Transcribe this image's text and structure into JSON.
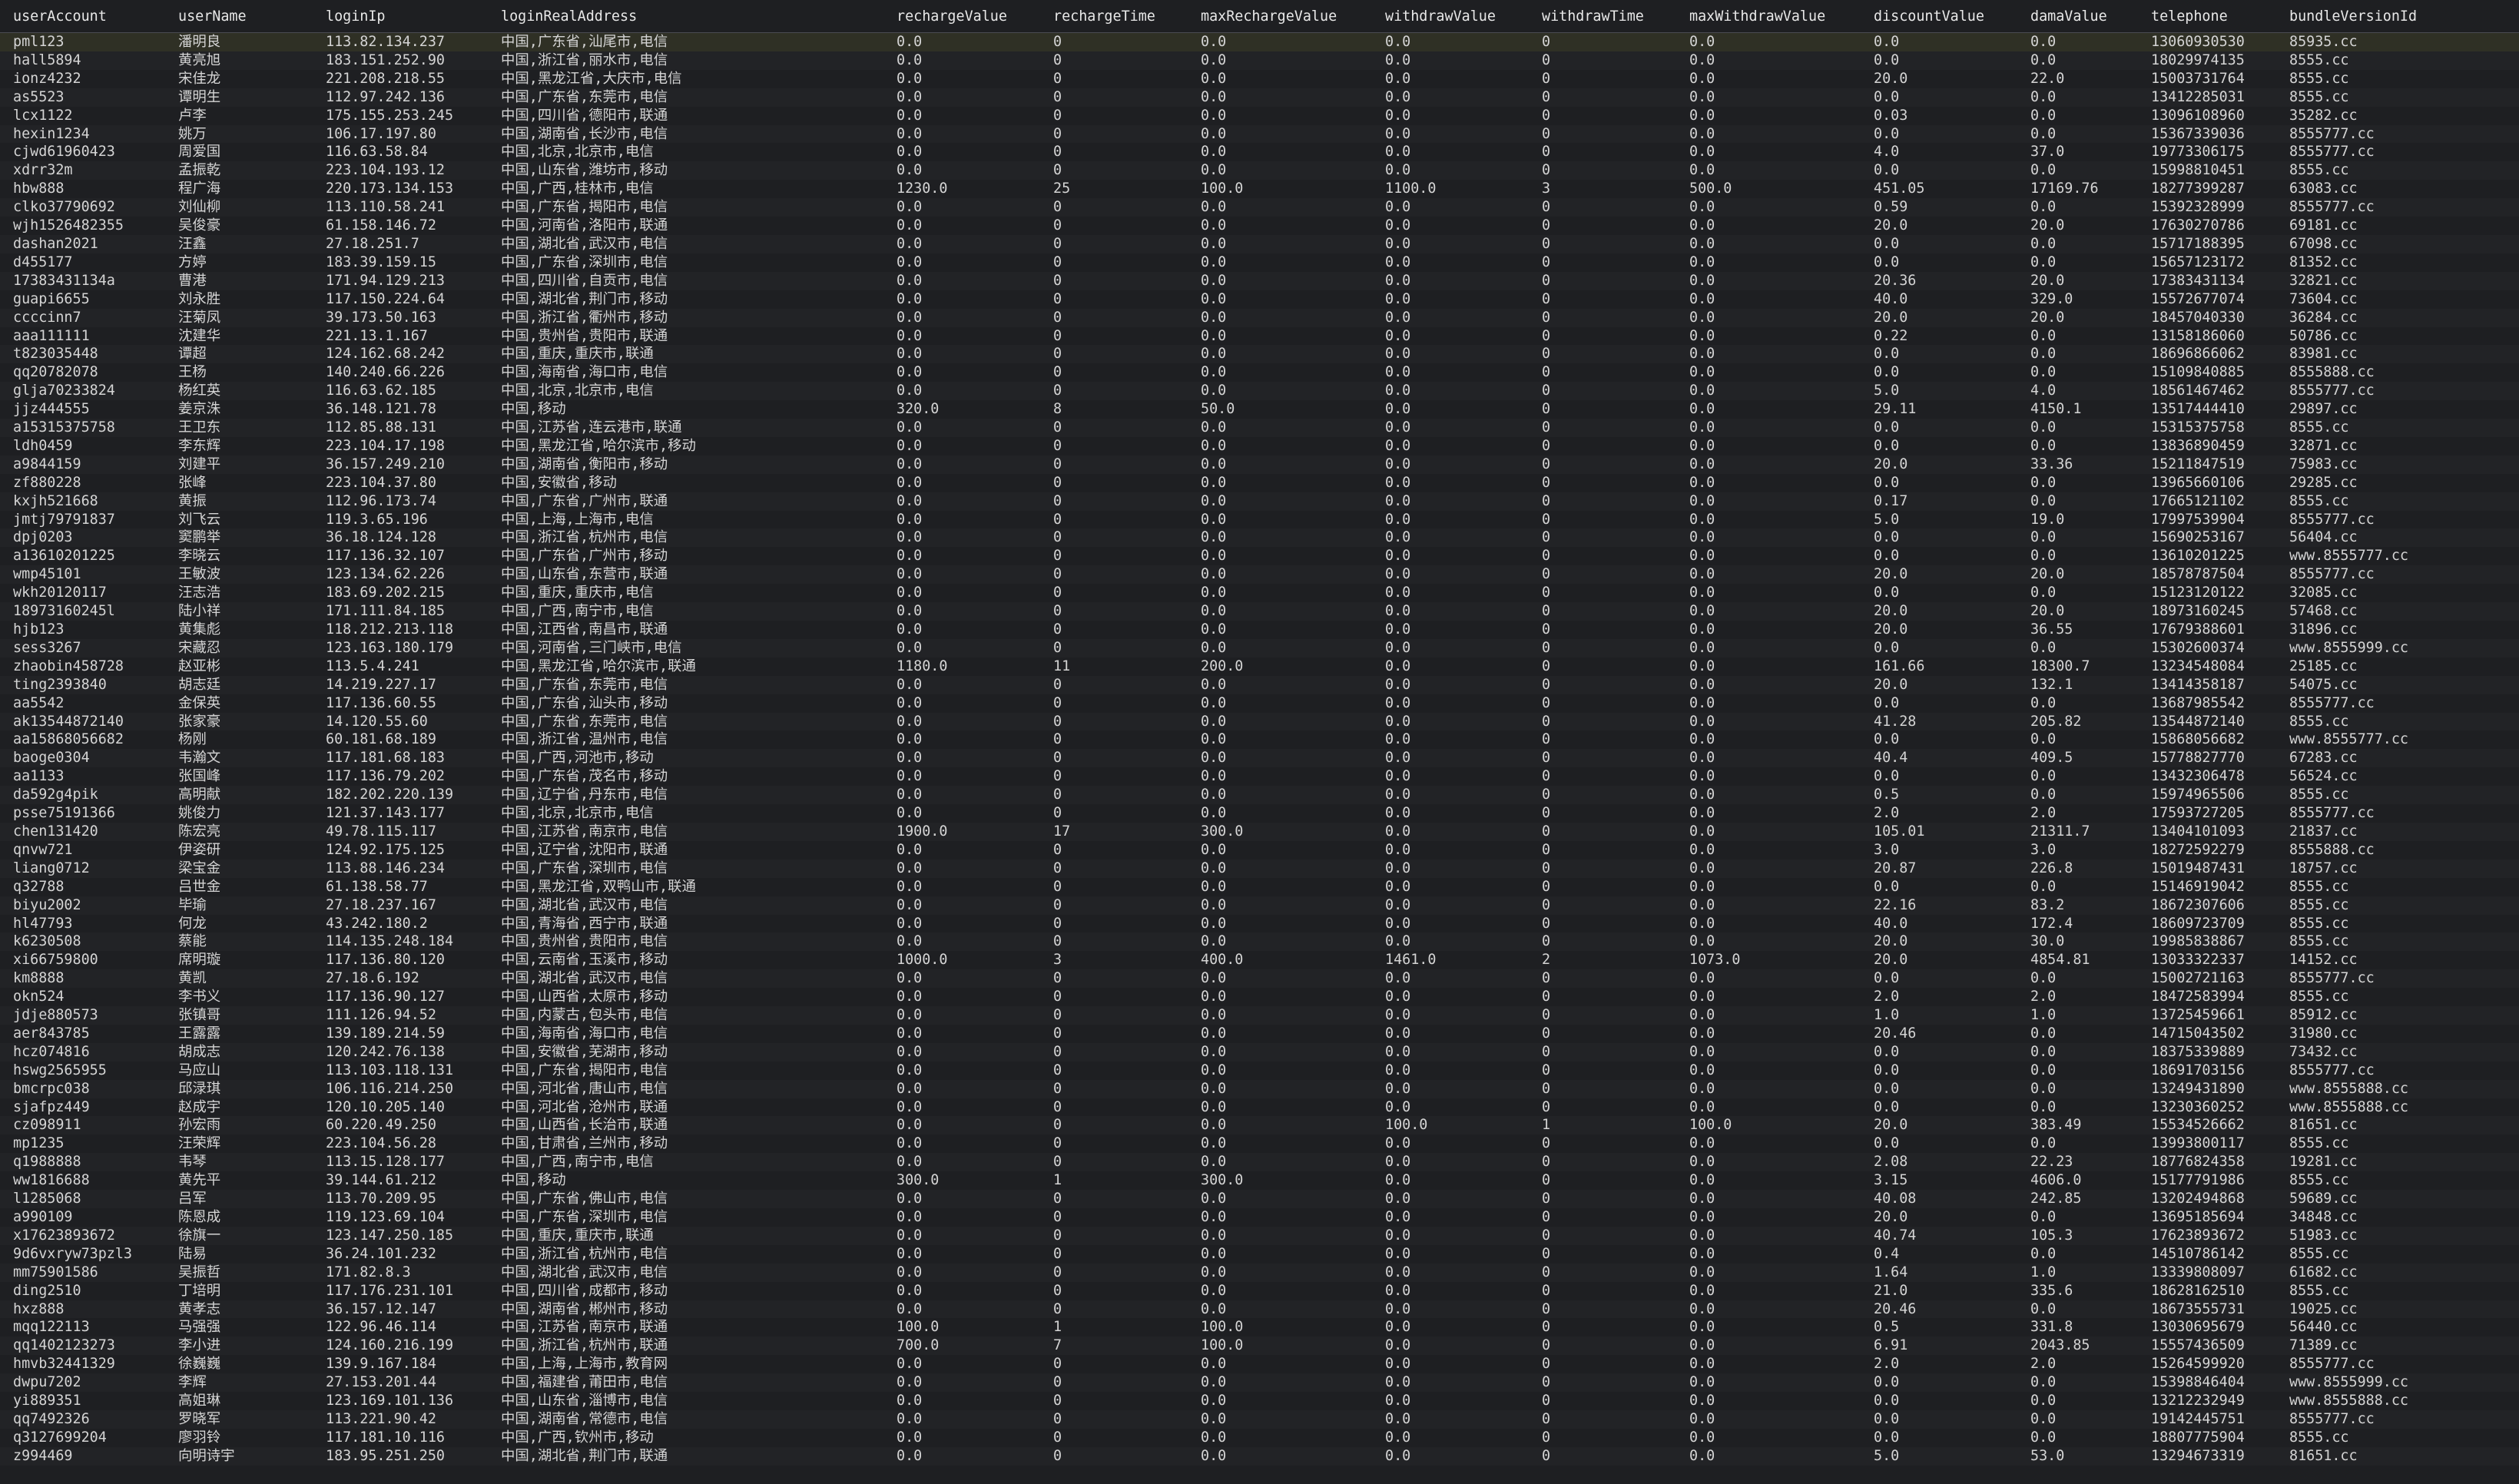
{
  "columns": [
    "userAccount",
    "userName",
    "loginIp",
    "loginRealAddress",
    "rechargeValue",
    "rechargeTime",
    "maxRechargeValue",
    "withdrawValue",
    "withdrawTime",
    "maxWithdrawValue",
    "discountValue",
    "damaValue",
    "telephone",
    "bundleVersionId"
  ],
  "colors": {
    "background": "#1e1f22",
    "text": "#d4d4d4",
    "selectedRow": "#2f3025"
  },
  "selected_row": 0,
  "rows": [
    [
      "pml123",
      "潘明良",
      "113.82.134.237",
      "中国,广东省,汕尾市,电信",
      "0.0",
      "0",
      "0.0",
      "0.0",
      "0",
      "0.0",
      "0.0",
      "0.0",
      "13060930530",
      "85935.cc"
    ],
    [
      "hall5894",
      "黄亮旭",
      "183.151.252.90",
      "中国,浙江省,丽水市,电信",
      "0.0",
      "0",
      "0.0",
      "0.0",
      "0",
      "0.0",
      "0.0",
      "0.0",
      "18029974135",
      "8555.cc"
    ],
    [
      "ionz4232",
      "宋佳龙",
      "221.208.218.55",
      "中国,黑龙江省,大庆市,电信",
      "0.0",
      "0",
      "0.0",
      "0.0",
      "0",
      "0.0",
      "20.0",
      "22.0",
      "15003731764",
      "8555.cc"
    ],
    [
      "as5523",
      "谭明生",
      "112.97.242.136",
      "中国,广东省,东莞市,电信",
      "0.0",
      "0",
      "0.0",
      "0.0",
      "0",
      "0.0",
      "0.0",
      "0.0",
      "13412285031",
      "8555.cc"
    ],
    [
      "lcx1122",
      "卢李",
      "175.155.253.245",
      "中国,四川省,德阳市,联通",
      "0.0",
      "0",
      "0.0",
      "0.0",
      "0",
      "0.0",
      "0.03",
      "0.0",
      "13096108960",
      "35282.cc"
    ],
    [
      "hexin1234",
      "姚万",
      "106.17.197.80",
      "中国,湖南省,长沙市,电信",
      "0.0",
      "0",
      "0.0",
      "0.0",
      "0",
      "0.0",
      "0.0",
      "0.0",
      "15367339036",
      "8555777.cc"
    ],
    [
      "cjwd61960423",
      "周爱国",
      "116.63.58.84",
      "中国,北京,北京市,电信",
      "0.0",
      "0",
      "0.0",
      "0.0",
      "0",
      "0.0",
      "4.0",
      "37.0",
      "19773306175",
      "8555777.cc"
    ],
    [
      "xdrr32m",
      "孟振乾",
      "223.104.193.12",
      "中国,山东省,潍坊市,移动",
      "0.0",
      "0",
      "0.0",
      "0.0",
      "0",
      "0.0",
      "0.0",
      "0.0",
      "15998810451",
      "8555.cc"
    ],
    [
      "hbw888",
      "程广海",
      "220.173.134.153",
      "中国,广西,桂林市,电信",
      "1230.0",
      "25",
      "100.0",
      "1100.0",
      "3",
      "500.0",
      "451.05",
      "17169.76",
      "18277399287",
      "63083.cc"
    ],
    [
      "clko37790692",
      "刘仙柳",
      "113.110.58.241",
      "中国,广东省,揭阳市,电信",
      "0.0",
      "0",
      "0.0",
      "0.0",
      "0",
      "0.0",
      "0.59",
      "0.0",
      "15392328999",
      "8555777.cc"
    ],
    [
      "wjh1526482355",
      "吴俊豪",
      "61.158.146.72",
      "中国,河南省,洛阳市,联通",
      "0.0",
      "0",
      "0.0",
      "0.0",
      "0",
      "0.0",
      "20.0",
      "20.0",
      "17630270786",
      "69181.cc"
    ],
    [
      "dashan2021",
      "汪鑫",
      "27.18.251.7",
      "中国,湖北省,武汉市,电信",
      "0.0",
      "0",
      "0.0",
      "0.0",
      "0",
      "0.0",
      "0.0",
      "0.0",
      "15717188395",
      "67098.cc"
    ],
    [
      "d455177",
      "方婷",
      "183.39.159.15",
      "中国,广东省,深圳市,电信",
      "0.0",
      "0",
      "0.0",
      "0.0",
      "0",
      "0.0",
      "0.0",
      "0.0",
      "15657123172",
      "81352.cc"
    ],
    [
      "17383431134a",
      "曹港",
      "171.94.129.213",
      "中国,四川省,自贡市,电信",
      "0.0",
      "0",
      "0.0",
      "0.0",
      "0",
      "0.0",
      "20.36",
      "20.0",
      "17383431134",
      "32821.cc"
    ],
    [
      "guapi6655",
      "刘永胜",
      "117.150.224.64",
      "中国,湖北省,荆门市,移动",
      "0.0",
      "0",
      "0.0",
      "0.0",
      "0",
      "0.0",
      "40.0",
      "329.0",
      "15572677074",
      "73604.cc"
    ],
    [
      "ccccinn7",
      "汪菊凤",
      "39.173.50.163",
      "中国,浙江省,衢州市,移动",
      "0.0",
      "0",
      "0.0",
      "0.0",
      "0",
      "0.0",
      "20.0",
      "20.0",
      "18457040330",
      "36284.cc"
    ],
    [
      "aaa111111",
      "沈建华",
      "221.13.1.167",
      "中国,贵州省,贵阳市,联通",
      "0.0",
      "0",
      "0.0",
      "0.0",
      "0",
      "0.0",
      "0.22",
      "0.0",
      "13158186060",
      "50786.cc"
    ],
    [
      "t823035448",
      "谭超",
      "124.162.68.242",
      "中国,重庆,重庆市,联通",
      "0.0",
      "0",
      "0.0",
      "0.0",
      "0",
      "0.0",
      "0.0",
      "0.0",
      "18696866062",
      "83981.cc"
    ],
    [
      "qq20782078",
      "王杨",
      "140.240.66.226",
      "中国,海南省,海口市,电信",
      "0.0",
      "0",
      "0.0",
      "0.0",
      "0",
      "0.0",
      "0.0",
      "0.0",
      "15109840885",
      "8555888.cc"
    ],
    [
      "glja70233824",
      "杨红英",
      "116.63.62.185",
      "中国,北京,北京市,电信",
      "0.0",
      "0",
      "0.0",
      "0.0",
      "0",
      "0.0",
      "5.0",
      "4.0",
      "18561467462",
      "8555777.cc"
    ],
    [
      "jjz444555",
      "姜京洙",
      "36.148.121.78",
      "中国,移动",
      "320.0",
      "8",
      "50.0",
      "0.0",
      "0",
      "0.0",
      "29.11",
      "4150.1",
      "13517444410",
      "29897.cc"
    ],
    [
      "a15315375758",
      "王卫东",
      "112.85.88.131",
      "中国,江苏省,连云港市,联通",
      "0.0",
      "0",
      "0.0",
      "0.0",
      "0",
      "0.0",
      "0.0",
      "0.0",
      "15315375758",
      "8555.cc"
    ],
    [
      "ldh0459",
      "李东辉",
      "223.104.17.198",
      "中国,黑龙江省,哈尔滨市,移动",
      "0.0",
      "0",
      "0.0",
      "0.0",
      "0",
      "0.0",
      "0.0",
      "0.0",
      "13836890459",
      "32871.cc"
    ],
    [
      "a9844159",
      "刘建平",
      "36.157.249.210",
      "中国,湖南省,衡阳市,移动",
      "0.0",
      "0",
      "0.0",
      "0.0",
      "0",
      "0.0",
      "20.0",
      "33.36",
      "15211847519",
      "75983.cc"
    ],
    [
      "zf880228",
      "张峰",
      "223.104.37.80",
      "中国,安徽省,移动",
      "0.0",
      "0",
      "0.0",
      "0.0",
      "0",
      "0.0",
      "0.0",
      "0.0",
      "13965660106",
      "29285.cc"
    ],
    [
      "kxjh521668",
      "黄振",
      "112.96.173.74",
      "中国,广东省,广州市,联通",
      "0.0",
      "0",
      "0.0",
      "0.0",
      "0",
      "0.0",
      "0.17",
      "0.0",
      "17665121102",
      "8555.cc"
    ],
    [
      "jmtj79791837",
      "刘飞云",
      "119.3.65.196",
      "中国,上海,上海市,电信",
      "0.0",
      "0",
      "0.0",
      "0.0",
      "0",
      "0.0",
      "5.0",
      "19.0",
      "17997539904",
      "8555777.cc"
    ],
    [
      "dpj0203",
      "窦鹏举",
      "36.18.124.128",
      "中国,浙江省,杭州市,电信",
      "0.0",
      "0",
      "0.0",
      "0.0",
      "0",
      "0.0",
      "0.0",
      "0.0",
      "15690253167",
      "56404.cc"
    ],
    [
      "a13610201225",
      "李晓云",
      "117.136.32.107",
      "中国,广东省,广州市,移动",
      "0.0",
      "0",
      "0.0",
      "0.0",
      "0",
      "0.0",
      "0.0",
      "0.0",
      "13610201225",
      "www.8555777.cc"
    ],
    [
      "wmp45101",
      "王敏波",
      "123.134.62.226",
      "中国,山东省,东营市,联通",
      "0.0",
      "0",
      "0.0",
      "0.0",
      "0",
      "0.0",
      "20.0",
      "20.0",
      "18578787504",
      "8555777.cc"
    ],
    [
      "wkh20120117",
      "汪志浩",
      "183.69.202.215",
      "中国,重庆,重庆市,电信",
      "0.0",
      "0",
      "0.0",
      "0.0",
      "0",
      "0.0",
      "0.0",
      "0.0",
      "15123120122",
      "32085.cc"
    ],
    [
      "18973160245l",
      "陆小祥",
      "171.111.84.185",
      "中国,广西,南宁市,电信",
      "0.0",
      "0",
      "0.0",
      "0.0",
      "0",
      "0.0",
      "20.0",
      "20.0",
      "18973160245",
      "57468.cc"
    ],
    [
      "hjb123",
      "黄集彪",
      "118.212.213.118",
      "中国,江西省,南昌市,联通",
      "0.0",
      "0",
      "0.0",
      "0.0",
      "0",
      "0.0",
      "20.0",
      "36.55",
      "17679388601",
      "31896.cc"
    ],
    [
      "sess3267",
      "宋藏忍",
      "123.163.180.179",
      "中国,河南省,三门峡市,电信",
      "0.0",
      "0",
      "0.0",
      "0.0",
      "0",
      "0.0",
      "0.0",
      "0.0",
      "15302600374",
      "www.8555999.cc"
    ],
    [
      "zhaobin458728",
      "赵亚彬",
      "113.5.4.241",
      "中国,黑龙江省,哈尔滨市,联通",
      "1180.0",
      "11",
      "200.0",
      "0.0",
      "0",
      "0.0",
      "161.66",
      "18300.7",
      "13234548084",
      "25185.cc"
    ],
    [
      "ting2393840",
      "胡志廷",
      "14.219.227.17",
      "中国,广东省,东莞市,电信",
      "0.0",
      "0",
      "0.0",
      "0.0",
      "0",
      "0.0",
      "20.0",
      "132.1",
      "13414358187",
      "54075.cc"
    ],
    [
      "aa5542",
      "金保英",
      "117.136.60.55",
      "中国,广东省,汕头市,移动",
      "0.0",
      "0",
      "0.0",
      "0.0",
      "0",
      "0.0",
      "0.0",
      "0.0",
      "13687985542",
      "8555777.cc"
    ],
    [
      "ak13544872140",
      "张家豪",
      "14.120.55.60",
      "中国,广东省,东莞市,电信",
      "0.0",
      "0",
      "0.0",
      "0.0",
      "0",
      "0.0",
      "41.28",
      "205.82",
      "13544872140",
      "8555.cc"
    ],
    [
      "aa15868056682",
      "杨刚",
      "60.181.68.189",
      "中国,浙江省,温州市,电信",
      "0.0",
      "0",
      "0.0",
      "0.0",
      "0",
      "0.0",
      "0.0",
      "0.0",
      "15868056682",
      "www.8555777.cc"
    ],
    [
      "baoge0304",
      "韦瀚文",
      "117.181.68.183",
      "中国,广西,河池市,移动",
      "0.0",
      "0",
      "0.0",
      "0.0",
      "0",
      "0.0",
      "40.4",
      "409.5",
      "15778827770",
      "67283.cc"
    ],
    [
      "aa1133",
      "张国峰",
      "117.136.79.202",
      "中国,广东省,茂名市,移动",
      "0.0",
      "0",
      "0.0",
      "0.0",
      "0",
      "0.0",
      "0.0",
      "0.0",
      "13432306478",
      "56524.cc"
    ],
    [
      "da592g4pik",
      "高明献",
      "182.202.220.139",
      "中国,辽宁省,丹东市,电信",
      "0.0",
      "0",
      "0.0",
      "0.0",
      "0",
      "0.0",
      "0.5",
      "0.0",
      "15974965506",
      "8555.cc"
    ],
    [
      "psse75191366",
      "姚俊力",
      "121.37.143.177",
      "中国,北京,北京市,电信",
      "0.0",
      "0",
      "0.0",
      "0.0",
      "0",
      "0.0",
      "2.0",
      "2.0",
      "17593727205",
      "8555777.cc"
    ],
    [
      "chen131420",
      "陈宏亮",
      "49.78.115.117",
      "中国,江苏省,南京市,电信",
      "1900.0",
      "17",
      "300.0",
      "0.0",
      "0",
      "0.0",
      "105.01",
      "21311.7",
      "13404101093",
      "21837.cc"
    ],
    [
      "qnvw721",
      "伊姿研",
      "124.92.175.125",
      "中国,辽宁省,沈阳市,联通",
      "0.0",
      "0",
      "0.0",
      "0.0",
      "0",
      "0.0",
      "3.0",
      "3.0",
      "18272592279",
      "8555888.cc"
    ],
    [
      "liang0712",
      "梁宝金",
      "113.88.146.234",
      "中国,广东省,深圳市,电信",
      "0.0",
      "0",
      "0.0",
      "0.0",
      "0",
      "0.0",
      "20.87",
      "226.8",
      "15019487431",
      "18757.cc"
    ],
    [
      "q32788",
      "吕世金",
      "61.138.58.77",
      "中国,黑龙江省,双鸭山市,联通",
      "0.0",
      "0",
      "0.0",
      "0.0",
      "0",
      "0.0",
      "0.0",
      "0.0",
      "15146919042",
      "8555.cc"
    ],
    [
      "biyu2002",
      "毕瑜",
      "27.18.237.167",
      "中国,湖北省,武汉市,电信",
      "0.0",
      "0",
      "0.0",
      "0.0",
      "0",
      "0.0",
      "22.16",
      "83.2",
      "18672307606",
      "8555.cc"
    ],
    [
      "hl47793",
      "何龙",
      "43.242.180.2",
      "中国,青海省,西宁市,联通",
      "0.0",
      "0",
      "0.0",
      "0.0",
      "0",
      "0.0",
      "40.0",
      "172.4",
      "18609723709",
      "8555.cc"
    ],
    [
      "k6230508",
      "蔡能",
      "114.135.248.184",
      "中国,贵州省,贵阳市,电信",
      "0.0",
      "0",
      "0.0",
      "0.0",
      "0",
      "0.0",
      "20.0",
      "30.0",
      "19985838867",
      "8555.cc"
    ],
    [
      "xi66759800",
      "席明璇",
      "117.136.80.120",
      "中国,云南省,玉溪市,移动",
      "1000.0",
      "3",
      "400.0",
      "1461.0",
      "2",
      "1073.0",
      "20.0",
      "4854.81",
      "13033322337",
      "14152.cc"
    ],
    [
      "km8888",
      "黄凯",
      "27.18.6.192",
      "中国,湖北省,武汉市,电信",
      "0.0",
      "0",
      "0.0",
      "0.0",
      "0",
      "0.0",
      "0.0",
      "0.0",
      "15002721163",
      "8555777.cc"
    ],
    [
      "okn524",
      "李书义",
      "117.136.90.127",
      "中国,山西省,太原市,移动",
      "0.0",
      "0",
      "0.0",
      "0.0",
      "0",
      "0.0",
      "2.0",
      "2.0",
      "18472583994",
      "8555.cc"
    ],
    [
      "jdje880573",
      "张镇哥",
      "111.126.94.52",
      "中国,内蒙古,包头市,电信",
      "0.0",
      "0",
      "0.0",
      "0.0",
      "0",
      "0.0",
      "1.0",
      "1.0",
      "13725459661",
      "85912.cc"
    ],
    [
      "aer843785",
      "王露露",
      "139.189.214.59",
      "中国,海南省,海口市,电信",
      "0.0",
      "0",
      "0.0",
      "0.0",
      "0",
      "0.0",
      "20.46",
      "0.0",
      "14715043502",
      "31980.cc"
    ],
    [
      "hcz074816",
      "胡成志",
      "120.242.76.138",
      "中国,安徽省,芜湖市,移动",
      "0.0",
      "0",
      "0.0",
      "0.0",
      "0",
      "0.0",
      "0.0",
      "0.0",
      "18375339889",
      "73432.cc"
    ],
    [
      "hswg2565955",
      "马应山",
      "113.103.118.131",
      "中国,广东省,揭阳市,电信",
      "0.0",
      "0",
      "0.0",
      "0.0",
      "0",
      "0.0",
      "0.0",
      "0.0",
      "18691703156",
      "8555777.cc"
    ],
    [
      "bmcrpc038",
      "邱渌琪",
      "106.116.214.250",
      "中国,河北省,唐山市,电信",
      "0.0",
      "0",
      "0.0",
      "0.0",
      "0",
      "0.0",
      "0.0",
      "0.0",
      "13249431890",
      "www.8555888.cc"
    ],
    [
      "sjafpz449",
      "赵成宇",
      "120.10.205.140",
      "中国,河北省,沧州市,联通",
      "0.0",
      "0",
      "0.0",
      "0.0",
      "0",
      "0.0",
      "0.0",
      "0.0",
      "13230360252",
      "www.8555888.cc"
    ],
    [
      "cz098911",
      "孙宏雨",
      "60.220.49.250",
      "中国,山西省,长治市,联通",
      "0.0",
      "0",
      "0.0",
      "100.0",
      "1",
      "100.0",
      "20.0",
      "383.49",
      "15534526662",
      "81651.cc"
    ],
    [
      "mp1235",
      "汪荣辉",
      "223.104.56.28",
      "中国,甘肃省,兰州市,移动",
      "0.0",
      "0",
      "0.0",
      "0.0",
      "0",
      "0.0",
      "0.0",
      "0.0",
      "13993800117",
      "8555.cc"
    ],
    [
      "q1988888",
      "韦琴",
      "113.15.128.177",
      "中国,广西,南宁市,电信",
      "0.0",
      "0",
      "0.0",
      "0.0",
      "0",
      "0.0",
      "2.08",
      "22.23",
      "18776824358",
      "19281.cc"
    ],
    [
      "ww1816688",
      "黄先平",
      "39.144.61.212",
      "中国,移动",
      "300.0",
      "1",
      "300.0",
      "0.0",
      "0",
      "0.0",
      "3.15",
      "4606.0",
      "15177791986",
      "8555.cc"
    ],
    [
      "l1285068",
      "吕军",
      "113.70.209.95",
      "中国,广东省,佛山市,电信",
      "0.0",
      "0",
      "0.0",
      "0.0",
      "0",
      "0.0",
      "40.08",
      "242.85",
      "13202494868",
      "59689.cc"
    ],
    [
      "a990109",
      "陈恩成",
      "119.123.69.104",
      "中国,广东省,深圳市,电信",
      "0.0",
      "0",
      "0.0",
      "0.0",
      "0",
      "0.0",
      "20.0",
      "0.0",
      "13695185694",
      "34848.cc"
    ],
    [
      "x17623893672",
      "徐旗一",
      "123.147.250.185",
      "中国,重庆,重庆市,联通",
      "0.0",
      "0",
      "0.0",
      "0.0",
      "0",
      "0.0",
      "40.74",
      "105.3",
      "17623893672",
      "51983.cc"
    ],
    [
      "9d6vxryw73pzl3",
      "陆易",
      "36.24.101.232",
      "中国,浙江省,杭州市,电信",
      "0.0",
      "0",
      "0.0",
      "0.0",
      "0",
      "0.0",
      "0.4",
      "0.0",
      "14510786142",
      "8555.cc"
    ],
    [
      "mm75901586",
      "吴振哲",
      "171.82.8.3",
      "中国,湖北省,武汉市,电信",
      "0.0",
      "0",
      "0.0",
      "0.0",
      "0",
      "0.0",
      "1.64",
      "1.0",
      "13339808097",
      "61682.cc"
    ],
    [
      "ding2510",
      "丁培明",
      "117.176.231.101",
      "中国,四川省,成都市,移动",
      "0.0",
      "0",
      "0.0",
      "0.0",
      "0",
      "0.0",
      "21.0",
      "335.6",
      "18628162510",
      "8555.cc"
    ],
    [
      "hxz888",
      "黄孝志",
      "36.157.12.147",
      "中国,湖南省,郴州市,移动",
      "0.0",
      "0",
      "0.0",
      "0.0",
      "0",
      "0.0",
      "20.46",
      "0.0",
      "18673555731",
      "19025.cc"
    ],
    [
      "mqq122113",
      "马强强",
      "122.96.46.114",
      "中国,江苏省,南京市,联通",
      "100.0",
      "1",
      "100.0",
      "0.0",
      "0",
      "0.0",
      "0.5",
      "331.8",
      "13030695679",
      "56440.cc"
    ],
    [
      "qq1402123273",
      "李小进",
      "124.160.216.199",
      "中国,浙江省,杭州市,联通",
      "700.0",
      "7",
      "100.0",
      "0.0",
      "0",
      "0.0",
      "6.91",
      "2043.85",
      "15557436509",
      "71389.cc"
    ],
    [
      "hmvb32441329",
      "徐巍巍",
      "139.9.167.184",
      "中国,上海,上海市,教育网",
      "0.0",
      "0",
      "0.0",
      "0.0",
      "0",
      "0.0",
      "2.0",
      "2.0",
      "15264599920",
      "8555777.cc"
    ],
    [
      "dwpu7202",
      "李辉",
      "27.153.201.44",
      "中国,福建省,莆田市,电信",
      "0.0",
      "0",
      "0.0",
      "0.0",
      "0",
      "0.0",
      "0.0",
      "0.0",
      "15398846404",
      "www.8555999.cc"
    ],
    [
      "yi889351",
      "高姐琳",
      "123.169.101.136",
      "中国,山东省,淄博市,电信",
      "0.0",
      "0",
      "0.0",
      "0.0",
      "0",
      "0.0",
      "0.0",
      "0.0",
      "13212232949",
      "www.8555888.cc"
    ],
    [
      "qq7492326",
      "罗晓军",
      "113.221.90.42",
      "中国,湖南省,常德市,电信",
      "0.0",
      "0",
      "0.0",
      "0.0",
      "0",
      "0.0",
      "0.0",
      "0.0",
      "19142445751",
      "8555777.cc"
    ],
    [
      "q3127699204",
      "廖羽铃",
      "117.181.10.116",
      "中国,广西,钦州市,移动",
      "0.0",
      "0",
      "0.0",
      "0.0",
      "0",
      "0.0",
      "0.0",
      "0.0",
      "18807775904",
      "8555.cc"
    ],
    [
      "z994469",
      "向明诗宇",
      "183.95.251.250",
      "中国,湖北省,荆门市,联通",
      "0.0",
      "0",
      "0.0",
      "0.0",
      "0",
      "0.0",
      "5.0",
      "53.0",
      "13294673319",
      "81651.cc"
    ]
  ]
}
